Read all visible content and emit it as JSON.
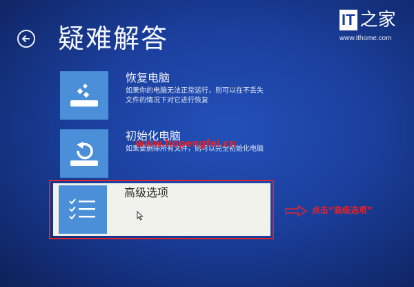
{
  "header": {
    "title": "疑难解答",
    "back_icon": "back-arrow-icon"
  },
  "options": [
    {
      "title": "恢复电脑",
      "description": "如果你的电脑无法正常运行，则可以在不丢失文件的情况下对它进行恢复",
      "icon": "refresh-icon"
    },
    {
      "title": "初始化电脑",
      "description": "如果要删除所有文件，则可以完全初始化电脑",
      "icon": "reset-icon"
    },
    {
      "title": "高级选项",
      "icon": "checklist-icon",
      "selected": true
    }
  ],
  "annotation": {
    "text": "点击“高级选项”",
    "color": "#e0242c"
  },
  "watermark": {
    "text": "www.hopengfei.cn"
  },
  "logo": {
    "brand": "IT",
    "brand_cn": "之家",
    "url": "www.ithome.com"
  },
  "colors": {
    "background": "#1b3f9d",
    "tile": "#4a8fd8",
    "highlight": "#e0242c"
  }
}
